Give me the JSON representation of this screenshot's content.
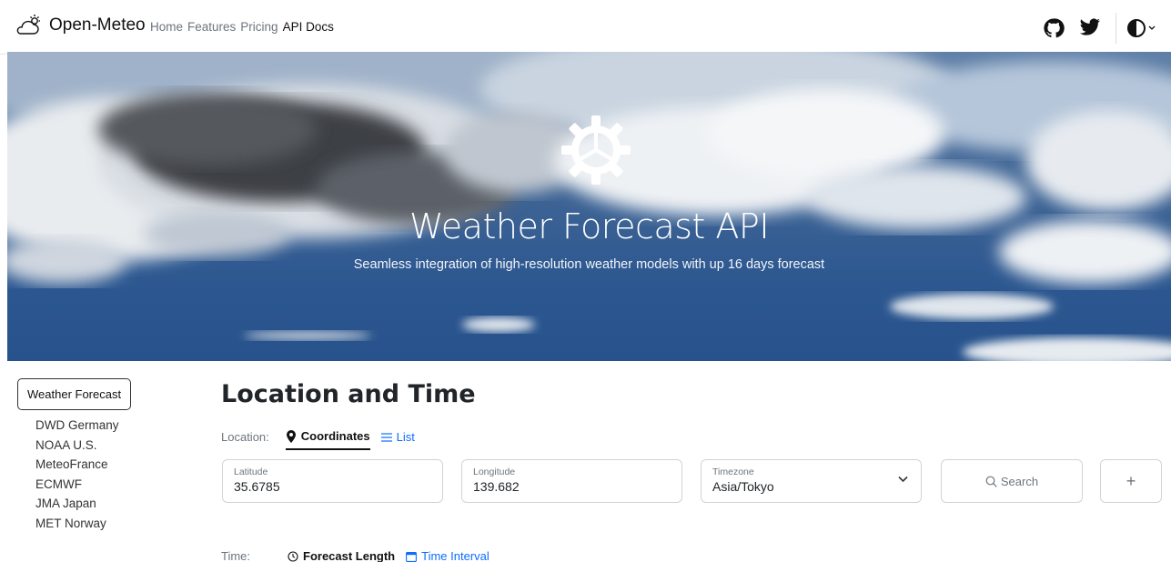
{
  "nav": {
    "brand": "Open-Meteo",
    "links": [
      {
        "label": "Home",
        "active": false
      },
      {
        "label": "Features",
        "active": false
      },
      {
        "label": "Pricing",
        "active": false
      },
      {
        "label": "API Docs",
        "active": true
      }
    ],
    "icons": [
      "github-icon",
      "twitter-icon",
      "theme-toggle-icon"
    ]
  },
  "hero": {
    "title": "Weather Forecast API",
    "subtitle": "Seamless integration of high-resolution weather models with up 16 days forecast"
  },
  "sidebar": {
    "active": "Weather Forecast",
    "items": [
      "DWD Germany",
      "NOAA U.S.",
      "MeteoFrance",
      "ECMWF",
      "JMA Japan",
      "MET Norway"
    ]
  },
  "main": {
    "title": "Location and Time",
    "location_label": "Location:",
    "tab_coordinates": "Coordinates",
    "tab_list": "List",
    "latitude": {
      "label": "Latitude",
      "value": "35.6785"
    },
    "longitude": {
      "label": "Longitude",
      "value": "139.682"
    },
    "timezone": {
      "label": "Timezone",
      "value": "Asia/Tokyo"
    },
    "search_label": "Search",
    "add_label": "+",
    "time_label": "Time:",
    "tab_forecast_length": "Forecast Length",
    "tab_time_interval": "Time Interval"
  },
  "colors": {
    "link": "#0d6efd",
    "text": "#212529",
    "muted": "#6c757d"
  }
}
